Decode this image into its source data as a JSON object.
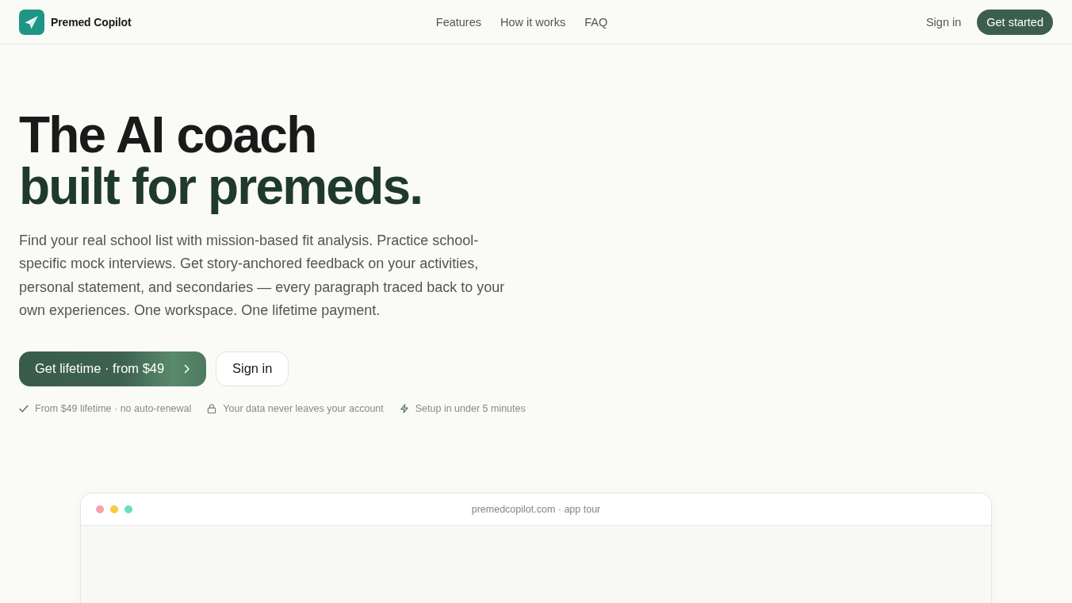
{
  "header": {
    "brand": "Premed Copilot",
    "nav": [
      "Features",
      "How it works",
      "FAQ"
    ],
    "sign_in": "Sign in",
    "cta": "Get started"
  },
  "hero": {
    "headline": [
      "The AI coach",
      "built for premeds."
    ],
    "description": "Find your real school list with mission-based fit analysis. Practice school-specific mock interviews. Get story-anchored feedback on your activities, personal statement, and secondaries — every paragraph traced back to your own experiences. One workspace. One lifetime payment.",
    "primary_button": "Get lifetime · from $49",
    "secondary_button": "Sign in",
    "badges": [
      {
        "kind": "check",
        "text": "From $49 lifetime · no auto-renewal"
      },
      {
        "kind": "lock",
        "text": "Your data never leaves your account"
      },
      {
        "kind": "bolt",
        "text": "Setup in under 5 minutes"
      }
    ]
  },
  "app_preview": {
    "dots": [
      {
        "color": "#f4a2ab"
      },
      {
        "color": "#f8cb40"
      },
      {
        "color": "#6ae0b8"
      }
    ],
    "caption": "premedcopilot.com · app tour"
  }
}
